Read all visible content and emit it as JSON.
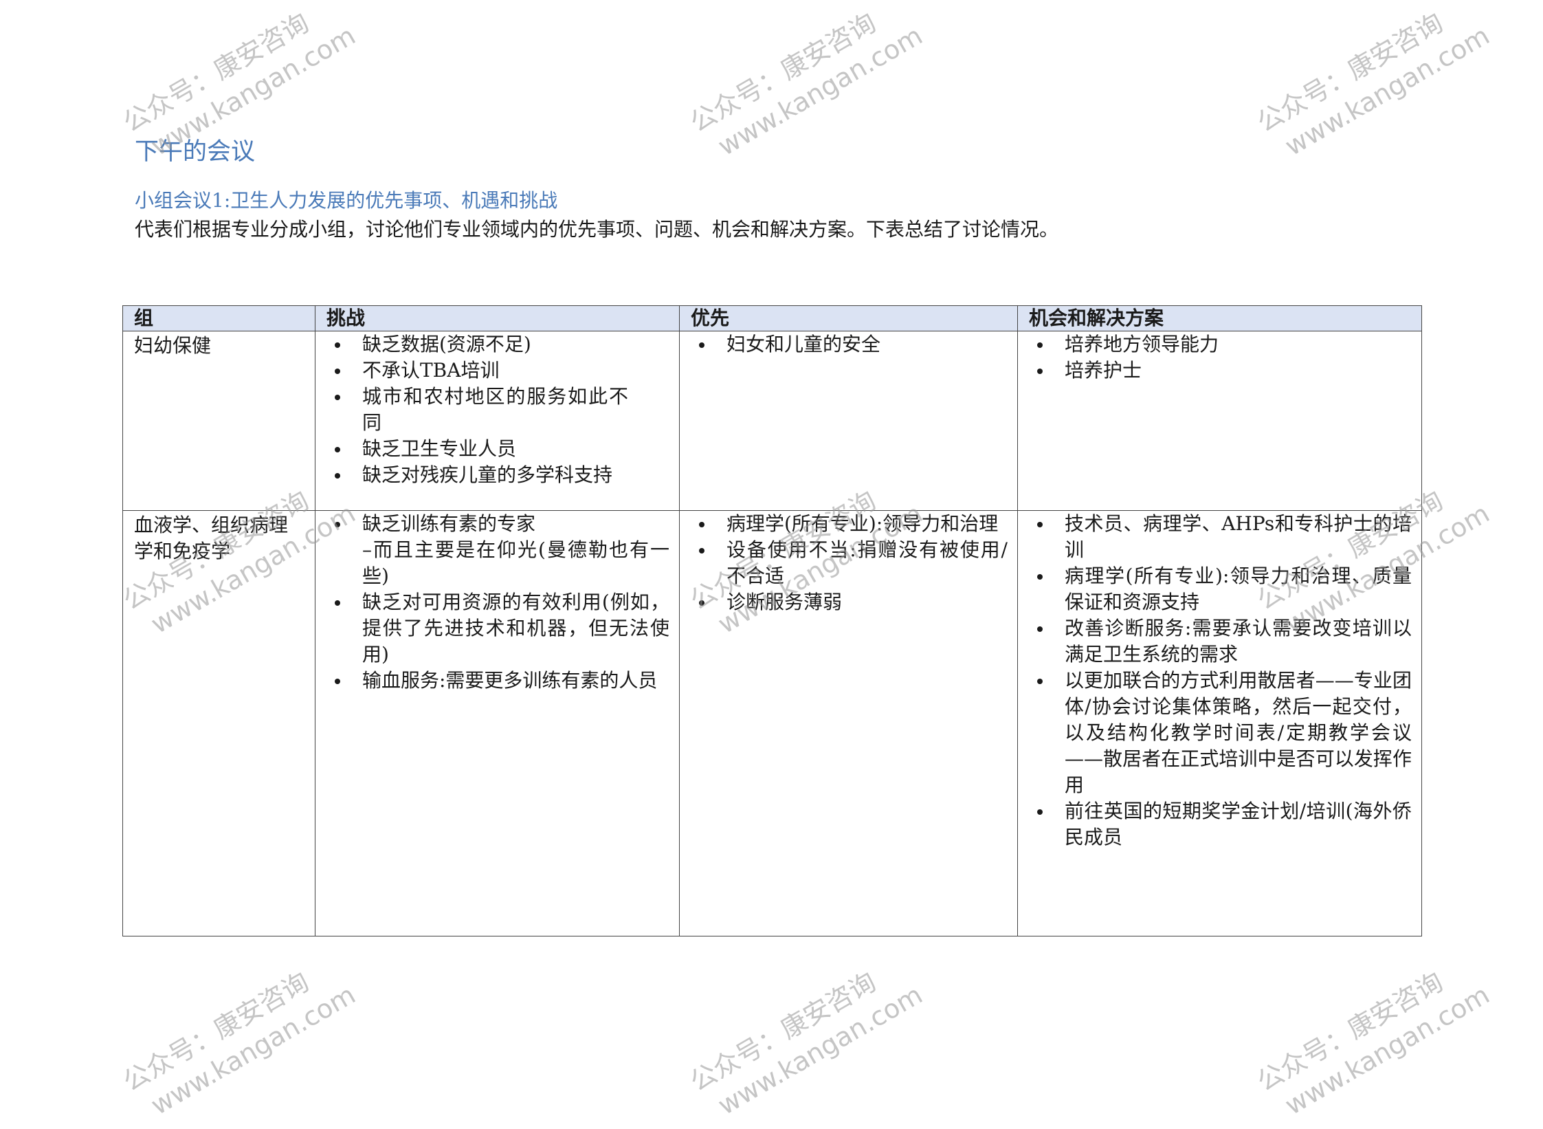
{
  "heading": "下午的会议",
  "subheading": "小组会议1:卫生人力发展的优先事项、机遇和挑战",
  "intro": "代表们根据专业分成小组，讨论他们专业领域内的优先事项、问题、机会和解决方案。下表总结了讨论情况。",
  "table": {
    "headers": [
      "组",
      "挑战",
      "优先",
      "机会和解决方案"
    ],
    "rows": [
      {
        "group": "妇幼保健",
        "challenges": [
          "缺乏数据(资源不足)",
          "不承认TBA培训",
          "城市和农村地区的服务如此不同",
          "缺乏卫生专业人员",
          "缺乏对残疾儿童的多学科支持"
        ],
        "priorities": [
          "妇女和儿童的安全"
        ],
        "opportunities": [
          "培养地方领导能力",
          "培养护士"
        ]
      },
      {
        "group": "血液学、组织病理学和免疫学",
        "challenges": [
          "缺乏训练有素的专家",
          "–而且主要是在仰光(曼德勒也有一些)",
          "缺乏对可用资源的有效利用(例如，提供了先进技术和机器，但无法使用)",
          "输血服务:需要更多训练有素的人员"
        ],
        "priorities": [
          "病理学(所有专业):领导力和治理",
          "设备使用不当:捐赠没有被使用/不合适",
          "诊断服务薄弱"
        ],
        "opportunities": [
          "技术员、病理学、AHPs和专科护士的培训",
          "病理学(所有专业):领导力和治理、质量保证和资源支持",
          "改善诊断服务:需要承认需要改变培训以满足卫生系统的需求",
          "以更加联合的方式利用散居者——专业团体/协会讨论集体策略，然后一起交付，以及结构化教学时间表/定期教学会议——散居者在正式培训中是否可以发挥作用",
          "前往英国的短期奖学金计划/培训(海外侨民成员"
        ]
      }
    ]
  },
  "watermark": {
    "line1": "公众号：康安咨询",
    "line2": "www.kangan.com"
  }
}
